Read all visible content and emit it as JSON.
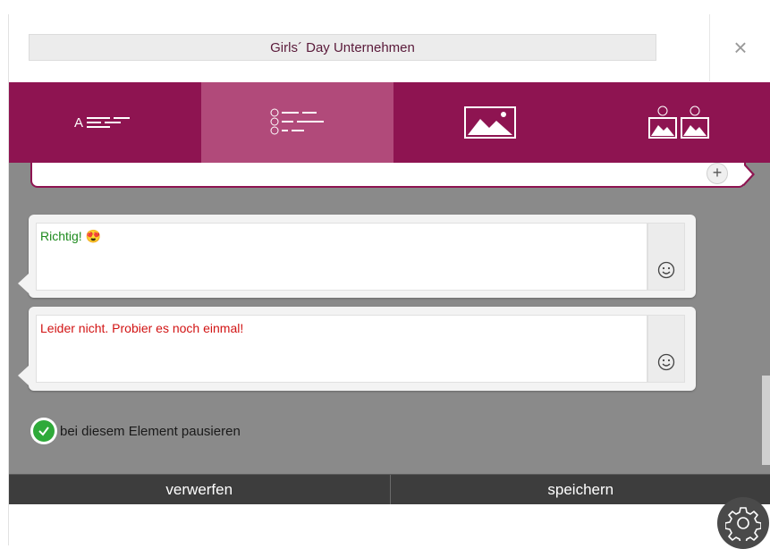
{
  "dialog": {
    "title": "Girls´ Day Unternehmen",
    "close_label": "×"
  },
  "tabs": [
    {
      "name": "text-answer",
      "icon": "text-lines-icon",
      "label": "A"
    },
    {
      "name": "multiple-choice",
      "icon": "abc-list-icon",
      "active": true
    },
    {
      "name": "image",
      "icon": "image-icon"
    },
    {
      "name": "image-choice",
      "icon": "image-ab-icon"
    }
  ],
  "prev_card": {
    "add_label": "+"
  },
  "feedback": {
    "correct_text": "Richtig! 😍",
    "correct_color": "#1e8a1e",
    "wrong_text": "Leider nicht. Probier es noch einmal!",
    "wrong_color": "#d21414"
  },
  "pause": {
    "label": "bei diesem Element pausieren",
    "checked": true
  },
  "footer": {
    "discard_label": "verwerfen",
    "save_label": "speichern"
  },
  "colors": {
    "brand": "#8e1451",
    "tab_active": "#b14a7a",
    "content_bg": "#8a8a8a"
  }
}
